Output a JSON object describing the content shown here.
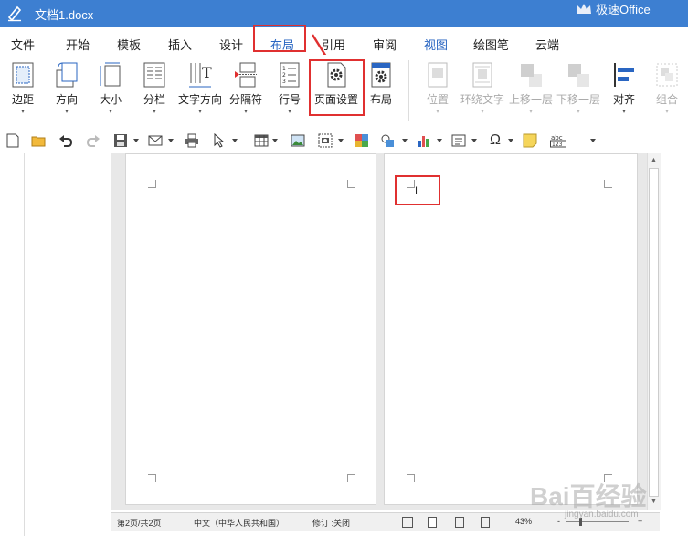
{
  "window": {
    "title": "文档1.docx",
    "brand": "极速Office"
  },
  "menu": {
    "tabs": [
      "文件",
      "开始",
      "模板",
      "插入",
      "设计",
      "布局",
      "引用",
      "审阅",
      "视图",
      "绘图笔",
      "云端"
    ],
    "active_tab": "布局"
  },
  "ribbon": {
    "buttons": [
      {
        "label": "边距",
        "icon": "margins-icon"
      },
      {
        "label": "方向",
        "icon": "orientation-icon"
      },
      {
        "label": "大小",
        "icon": "page-size-icon"
      },
      {
        "label": "分栏",
        "icon": "columns-icon"
      },
      {
        "label": "文字方向",
        "icon": "text-direction-icon"
      },
      {
        "label": "分隔符",
        "icon": "breaks-icon"
      },
      {
        "label": "行号",
        "icon": "line-numbers-icon"
      },
      {
        "label": "页面设置",
        "icon": "page-setup-icon"
      },
      {
        "label": "布局",
        "icon": "layout-gear-icon"
      },
      {
        "label": "位置",
        "icon": "position-icon",
        "disabled": true
      },
      {
        "label": "环绕文字",
        "icon": "wrap-text-icon",
        "disabled": true
      },
      {
        "label": "上移一层",
        "icon": "bring-forward-icon",
        "disabled": true
      },
      {
        "label": "下移一层",
        "icon": "send-backward-icon",
        "disabled": true
      },
      {
        "label": "对齐",
        "icon": "align-icon"
      },
      {
        "label": "组合",
        "icon": "group-icon",
        "disabled": true
      }
    ]
  },
  "document": {
    "cursor_char": "I"
  },
  "status": {
    "page": "第2页/共2页",
    "language": "中文（中华人民共和国）",
    "track_changes": "修订 :关闭",
    "zoom": "43%",
    "zoom_minus": "-",
    "zoom_plus": "+"
  },
  "watermark": {
    "text": "Bai百经验",
    "sub": "jingyan.baidu.com"
  },
  "colors": {
    "titlebar": "#3d7fd1",
    "highlight": "#e03030",
    "active_tab": "#2a66c2"
  }
}
